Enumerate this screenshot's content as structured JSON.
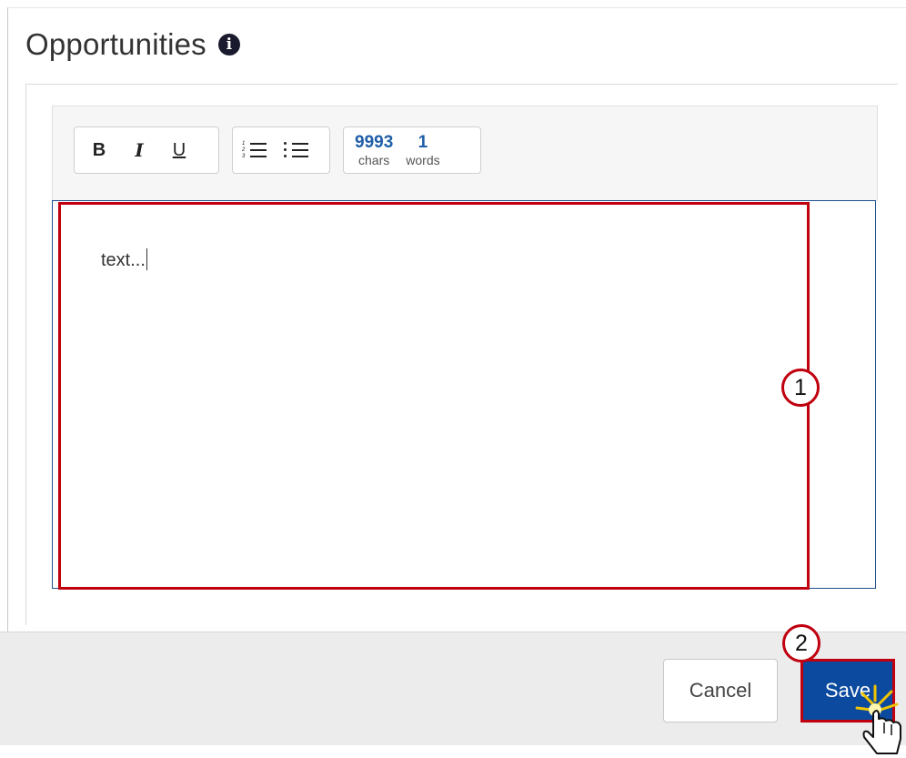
{
  "section": {
    "title": "Opportunities"
  },
  "toolbar": {
    "bold_label": "B",
    "italic_label": "I",
    "underline_label": "U",
    "chars_value": "9993",
    "chars_label": "chars",
    "words_value": "1",
    "words_label": "words"
  },
  "editor": {
    "text": "text..."
  },
  "callouts": {
    "editor_marker": "1",
    "save_marker": "2"
  },
  "footer": {
    "cancel_label": "Cancel",
    "save_label": "Save"
  },
  "icons": {
    "info": "info-icon",
    "ordered_list": "ordered-list-icon",
    "bullet_list": "bullet-list-icon",
    "hand_cursor": "hand-pointer-icon"
  },
  "colors": {
    "primary": "#0b4a9e",
    "highlight": "#c0000f",
    "counter": "#1f5fa8"
  }
}
